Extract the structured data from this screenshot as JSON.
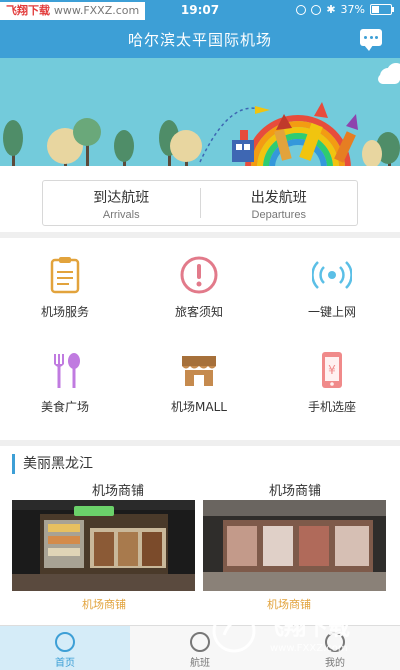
{
  "status_bar": {
    "watermark_title": "飞翔下载",
    "watermark_url": "www.FXXZ.com",
    "time": "19:07",
    "battery": "37%"
  },
  "header": {
    "title": "哈尔滨太平国际机场"
  },
  "flights": {
    "arrivals_cn": "到达航班",
    "arrivals_en": "Arrivals",
    "departures_cn": "出发航班",
    "departures_en": "Departures"
  },
  "services": [
    {
      "label": "机场服务",
      "icon": "clipboard-icon"
    },
    {
      "label": "旅客须知",
      "icon": "alert-icon"
    },
    {
      "label": "一键上网",
      "icon": "wifi-icon"
    },
    {
      "label": "美食广场",
      "icon": "fork-icon"
    },
    {
      "label": "机场MALL",
      "icon": "shop-icon"
    },
    {
      "label": "手机选座",
      "icon": "phone-seat-icon"
    }
  ],
  "section": {
    "title": "美丽黑龙江"
  },
  "shops": [
    {
      "heading": "机场商铺",
      "caption": "机场商铺"
    },
    {
      "heading": "机场商铺",
      "caption": "机场商铺"
    }
  ],
  "bottom_nav": [
    {
      "label": "首页",
      "active": true
    },
    {
      "label": "航班",
      "active": false
    },
    {
      "label": "我的",
      "active": false
    }
  ],
  "watermark_logo": {
    "text": "飞翔下载",
    "url": "www.FXXZ.com"
  },
  "colors": {
    "primary": "#3d9fd6",
    "banner_sky": "#73cbdb",
    "accent_orange": "#e2a33c",
    "icon_pink": "#e27a8a"
  }
}
